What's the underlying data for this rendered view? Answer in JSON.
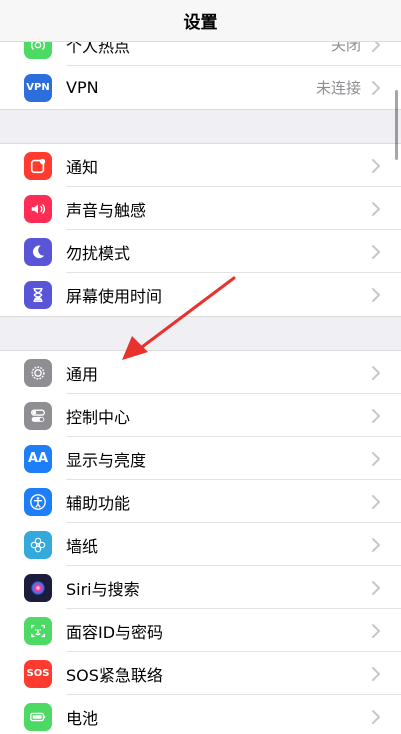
{
  "navbar": {
    "title": "设置"
  },
  "colors": {
    "arrow": "#e8322d"
  },
  "groups": [
    {
      "rows": [
        {
          "label": "个人热点",
          "value": "关闭",
          "icon": "hotspot-icon",
          "color": "#4cd964"
        },
        {
          "label": "VPN",
          "value": "未连接",
          "icon": "vpn-icon",
          "icon_text": "VPN",
          "color": "#2c6fdc"
        }
      ]
    },
    {
      "rows": [
        {
          "label": "通知",
          "icon": "notification-icon",
          "color": "#ff3b30"
        },
        {
          "label": "声音与触感",
          "icon": "speaker-icon",
          "color": "#ff2d55"
        },
        {
          "label": "勿扰模式",
          "icon": "moon-icon",
          "color": "#5856d6"
        },
        {
          "label": "屏幕使用时间",
          "icon": "hourglass-icon",
          "color": "#5856d6"
        }
      ]
    },
    {
      "rows": [
        {
          "label": "通用",
          "icon": "gear-icon",
          "color": "#8e8e93"
        },
        {
          "label": "控制中心",
          "icon": "toggle-icon",
          "color": "#8e8e93"
        },
        {
          "label": "显示与亮度",
          "icon": "text-size-icon",
          "icon_text": "AA",
          "color": "#1e7ef7"
        },
        {
          "label": "辅助功能",
          "icon": "accessibility-icon",
          "color": "#1e7ef7"
        },
        {
          "label": "墙纸",
          "icon": "flower-icon",
          "color": "#34aadc"
        },
        {
          "label": "Siri与搜索",
          "icon": "siri-icon",
          "color": "#1c1c3c"
        },
        {
          "label": "面容ID与密码",
          "icon": "face-id-icon",
          "color": "#4cd964"
        },
        {
          "label": "SOS紧急联络",
          "icon": "sos-icon",
          "icon_text": "SOS",
          "color": "#ff3b30"
        },
        {
          "label": "电池",
          "icon": "battery-icon",
          "color": "#4cd964"
        }
      ]
    }
  ]
}
